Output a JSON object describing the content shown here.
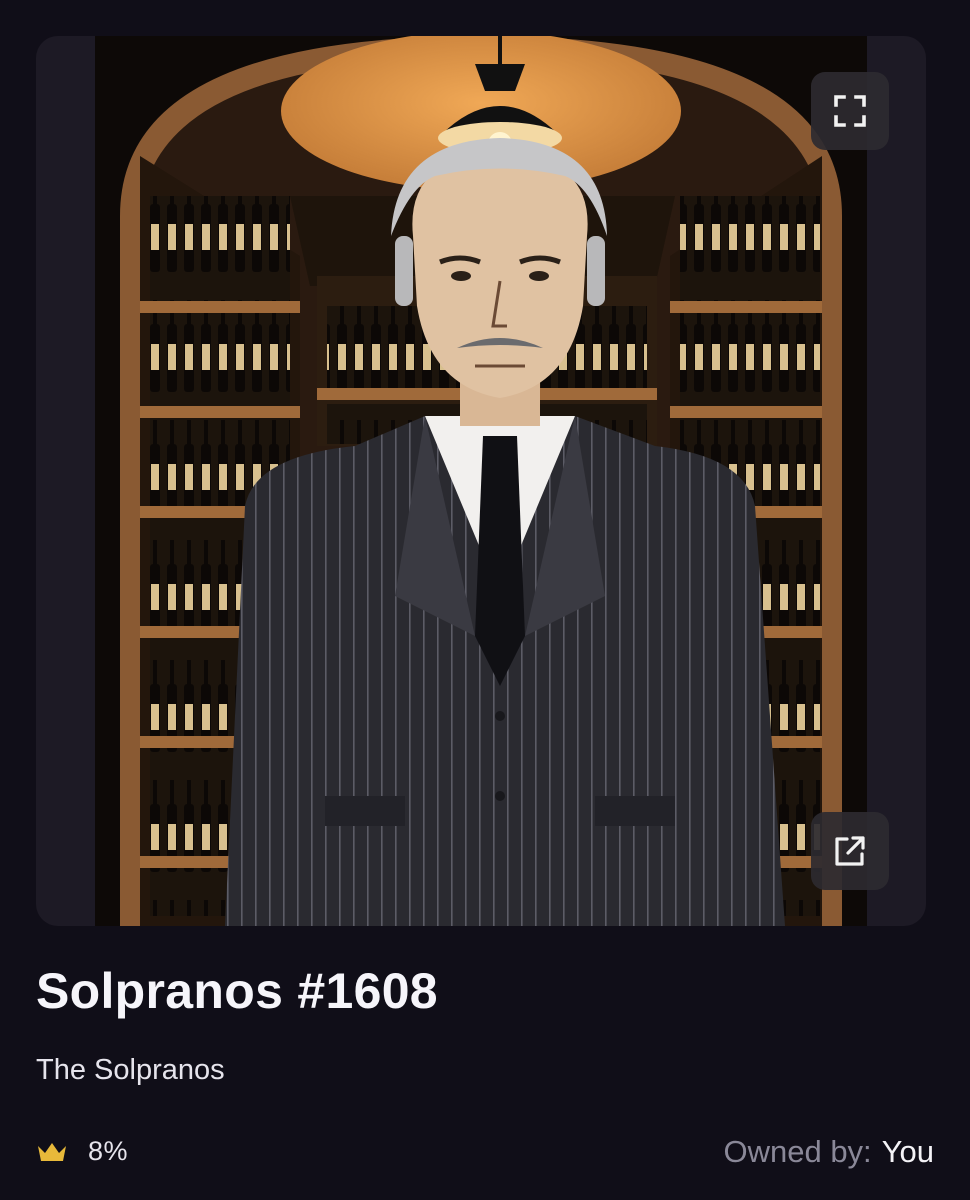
{
  "nft": {
    "title": "Solpranos #1608",
    "collection": "The Solpranos",
    "rarity": "8%",
    "owner_label": "Owned by:",
    "owner_value": "You"
  },
  "icons": {
    "expand": "expand-icon",
    "external_link": "external-link-icon",
    "rarity": "crown-icon"
  },
  "colors": {
    "background": "#100e18",
    "card": "#1d1a25",
    "crown": "#e8b93a",
    "muted_text": "#8a8898"
  }
}
